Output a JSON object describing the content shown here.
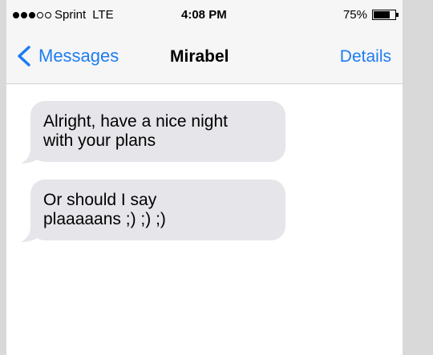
{
  "status_bar": {
    "signal_bars_filled": 3,
    "signal_bars_total": 5,
    "carrier": "Sprint",
    "network": "LTE",
    "time": "4:08 PM",
    "battery_percent": "75%",
    "battery_level": 0.75
  },
  "nav": {
    "back_label": "Messages",
    "title": "Mirabel",
    "details_label": "Details"
  },
  "messages": [
    {
      "direction": "incoming",
      "text": "Alright, have a nice night\nwith your plans"
    },
    {
      "direction": "incoming",
      "text": "Or should I say\nplaaaaans ;) ;) ;)"
    }
  ],
  "colors": {
    "accent": "#1d7cf2",
    "incoming_bubble": "#e5e5ea",
    "nav_background": "#f6f6f7",
    "page_background": "#d9d9d9"
  }
}
